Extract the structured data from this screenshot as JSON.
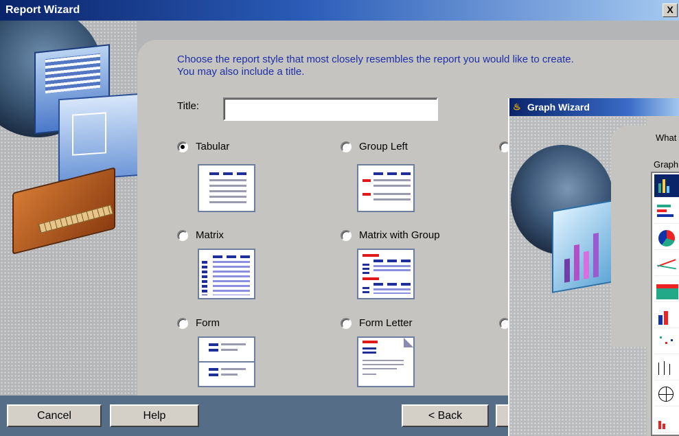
{
  "window": {
    "title": "Report Wizard",
    "close_label": "X"
  },
  "main": {
    "instruction_line1": "Choose the report style that most closely resembles the report you would like to create.",
    "instruction_line2": "You may also include a title.",
    "title_label": "Title:",
    "title_value": ""
  },
  "styles": [
    {
      "label": "Tabular",
      "selected": true
    },
    {
      "label": "Group Left",
      "selected": false
    },
    {
      "label": "Matrix",
      "selected": false
    },
    {
      "label": "Matrix with Group",
      "selected": false
    },
    {
      "label": "Form",
      "selected": false
    },
    {
      "label": "Form Letter",
      "selected": false
    }
  ],
  "buttons": {
    "cancel": "Cancel",
    "help": "Help",
    "back": "< Back"
  },
  "graph_wizard": {
    "title": "Graph Wizard",
    "what_text": "What",
    "graph_text": "Graph"
  },
  "colors": {
    "accent": "#1c2fa8",
    "titlebar": "#0a246a",
    "footer": "#566d87"
  }
}
